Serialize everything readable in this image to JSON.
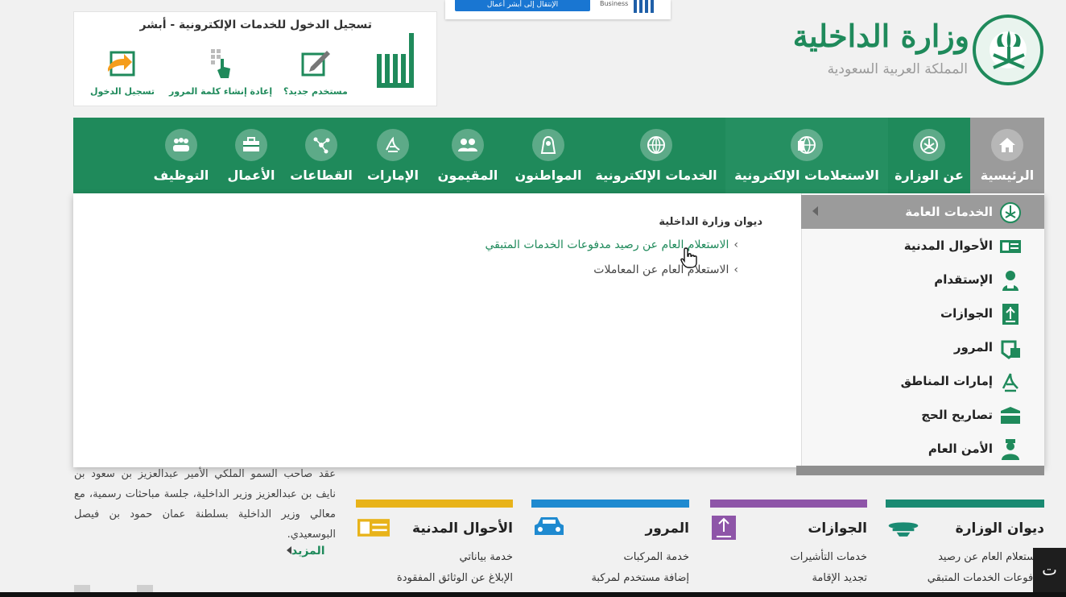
{
  "brand": {
    "ministry_name": "وزارة الداخلية",
    "country_name": "المملكة العربية السعودية",
    "accent": "#1f8a5b"
  },
  "absher_business": {
    "button_label": "الإنتقال إلى أبشر أعمال",
    "label": "Business"
  },
  "login": {
    "title": "تسجيل الدخول للخدمات الإلكترونية - أبشر",
    "items": [
      {
        "label": "مستخدم جديد؟",
        "icon": "new-user-icon"
      },
      {
        "label": "إعادة إنشاء كلمة المرور",
        "icon": "reset-password-icon"
      },
      {
        "label": "تسجيل الدخول",
        "icon": "login-icon"
      }
    ]
  },
  "nav": {
    "items": [
      {
        "label": "الرئيسية",
        "icon": "home-icon"
      },
      {
        "label": "عن الوزارة",
        "icon": "emblem-icon"
      },
      {
        "label": "الاستعلامات الإلكترونية",
        "icon": "inquiry-globe-icon"
      },
      {
        "label": "الخدمات الإلكترونية",
        "icon": "globe-icon"
      },
      {
        "label": "المواطنون",
        "icon": "citizens-icon"
      },
      {
        "label": "المقيمون",
        "icon": "residents-icon"
      },
      {
        "label": "الإمارات",
        "icon": "emirates-icon"
      },
      {
        "label": "القطاعات",
        "icon": "sectors-icon"
      },
      {
        "label": "الأعمال",
        "icon": "briefcase-icon"
      },
      {
        "label": "التوظيف",
        "icon": "employment-icon"
      }
    ]
  },
  "dropdown": {
    "side_items": [
      {
        "label": "الخدمات العامة",
        "icon": "emblem-icon"
      },
      {
        "label": "الأحوال المدنية",
        "icon": "id-card-icon"
      },
      {
        "label": "الإستقدام",
        "icon": "recruitment-icon"
      },
      {
        "label": "الجوازات",
        "icon": "passport-icon"
      },
      {
        "label": "المرور",
        "icon": "traffic-icon"
      },
      {
        "label": "إمارات المناطق",
        "icon": "emirates-icon"
      },
      {
        "label": "تصاريح الحج",
        "icon": "kaaba-icon"
      },
      {
        "label": "الأمن العام",
        "icon": "police-icon"
      }
    ],
    "group_title": "ديوان وزارة الداخلية",
    "links": [
      {
        "label": "الاستعلام العام عن رصيد مدفوعات الخدمات المتبقي"
      },
      {
        "label": "الاستعلام العام عن المعاملات"
      }
    ]
  },
  "news": {
    "text": "عقد صاحب السمو الملكي الأمير عبدالعزيز بن سعود بن نايف بن عبدالعزيز وزير الداخلية، جلسة مباحثات رسمية، مع معالي وزير الداخلية بسلطنة عمان حمود بن فيصل البوسعيدي.",
    "more_label": "المزيد"
  },
  "cards": [
    {
      "title": "ديوان الوزارة",
      "color": "#1a8a72",
      "line1": "الاستعلام العام عن رصيد",
      "line2": "مدفوعات الخدمات المتبقي",
      "icon": "ministry-icon"
    },
    {
      "title": "الجوازات",
      "color": "#8e55a8",
      "line1": "خدمات التأشيرات",
      "line2": "تجديد الإقامة",
      "icon": "passport-icon"
    },
    {
      "title": "المرور",
      "color": "#1f8ad0",
      "line1": "خدمة المركبات",
      "line2": "إضافة مستخدم لمركبة",
      "icon": "car-icon"
    },
    {
      "title": "الأحوال المدنية",
      "color": "#e8b31a",
      "line1": "خدمة بياناتي",
      "line2": "الإبلاغ عن الوثائق المفقودة",
      "icon": "id-card-icon"
    }
  ],
  "overlay_char": "ت"
}
